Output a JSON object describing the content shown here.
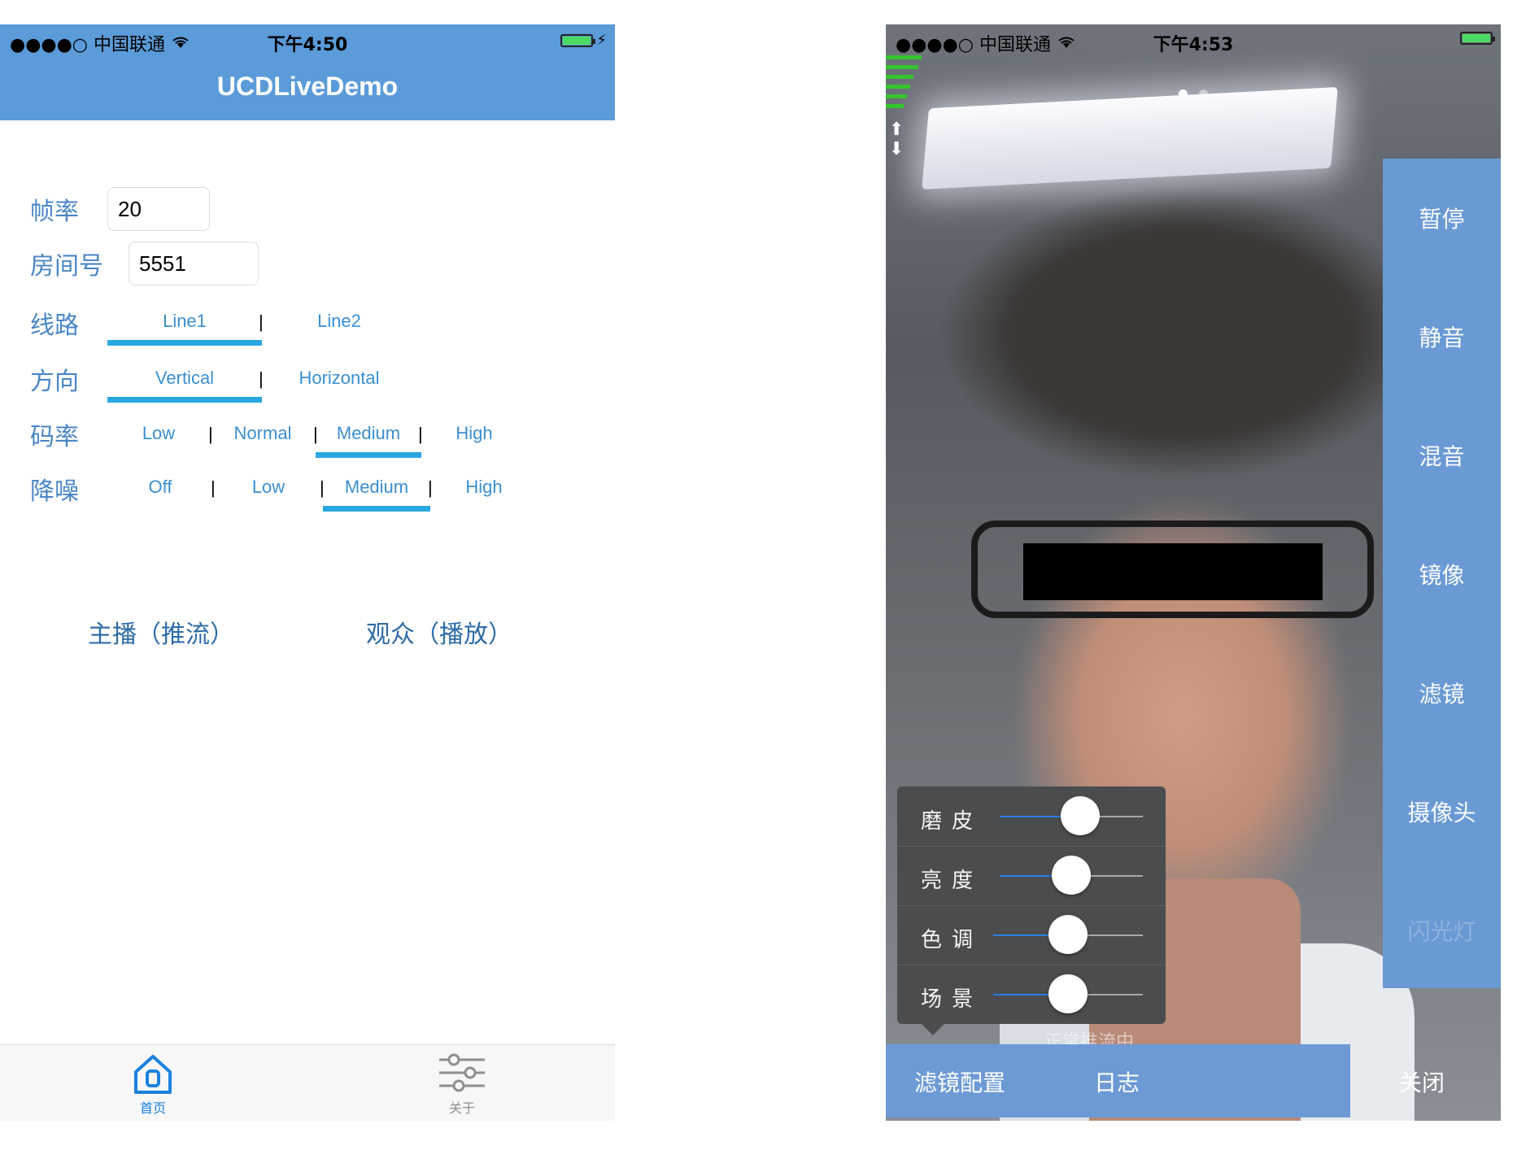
{
  "left": {
    "status": {
      "carrier": "●●●●○ 中国联通",
      "time": "下午4:50"
    },
    "title": "UCDLiveDemo",
    "form": {
      "fps_label": "帧率",
      "fps_value": "20",
      "room_label": "房间号",
      "room_value": "5551",
      "line_label": "线路",
      "line_options": [
        "Line1",
        "Line2"
      ],
      "line_selected": "Line1",
      "orientation_label": "方向",
      "orientation_options": [
        "Vertical",
        "Horizontal"
      ],
      "orientation_selected": "Vertical",
      "bitrate_label": "码率",
      "bitrate_options": [
        "Low",
        "Normal",
        "Medium",
        "High"
      ],
      "bitrate_selected": "Medium",
      "denoise_label": "降噪",
      "denoise_options": [
        "Off",
        "Low",
        "Medium",
        "High"
      ],
      "denoise_selected": "Medium",
      "separator": "|"
    },
    "actions": {
      "anchor": "主播（推流）",
      "audience": "观众（播放）"
    },
    "tabs": [
      {
        "label": "首页",
        "icon": "home-icon",
        "active": true
      },
      {
        "label": "关于",
        "icon": "sliders-icon",
        "active": false
      }
    ],
    "colors": {
      "nav": "#5b9bd9",
      "accent": "#3a8fd2",
      "underline": "#29a7e1"
    }
  },
  "right": {
    "status": {
      "carrier": "●●●●○ 中国联通",
      "time": "下午4:53"
    },
    "side_buttons": [
      "暂停",
      "静音",
      "混音",
      "镜像",
      "滤镜",
      "摄像头",
      "闪光灯"
    ],
    "side_disabled": "闪光灯",
    "filters": [
      {
        "label": "磨皮",
        "level": 0.56
      },
      {
        "label": "亮度",
        "level": 0.5
      },
      {
        "label": "色调",
        "level": 0.5
      },
      {
        "label": "场景",
        "level": 0.5
      }
    ],
    "overlay_status": "正常推流中",
    "bottom": {
      "filter_config": "滤镜配置",
      "log": "日志",
      "close": "关闭"
    },
    "colors": {
      "panel": "#6a9ad4",
      "slider": "#2a7fe3"
    }
  }
}
